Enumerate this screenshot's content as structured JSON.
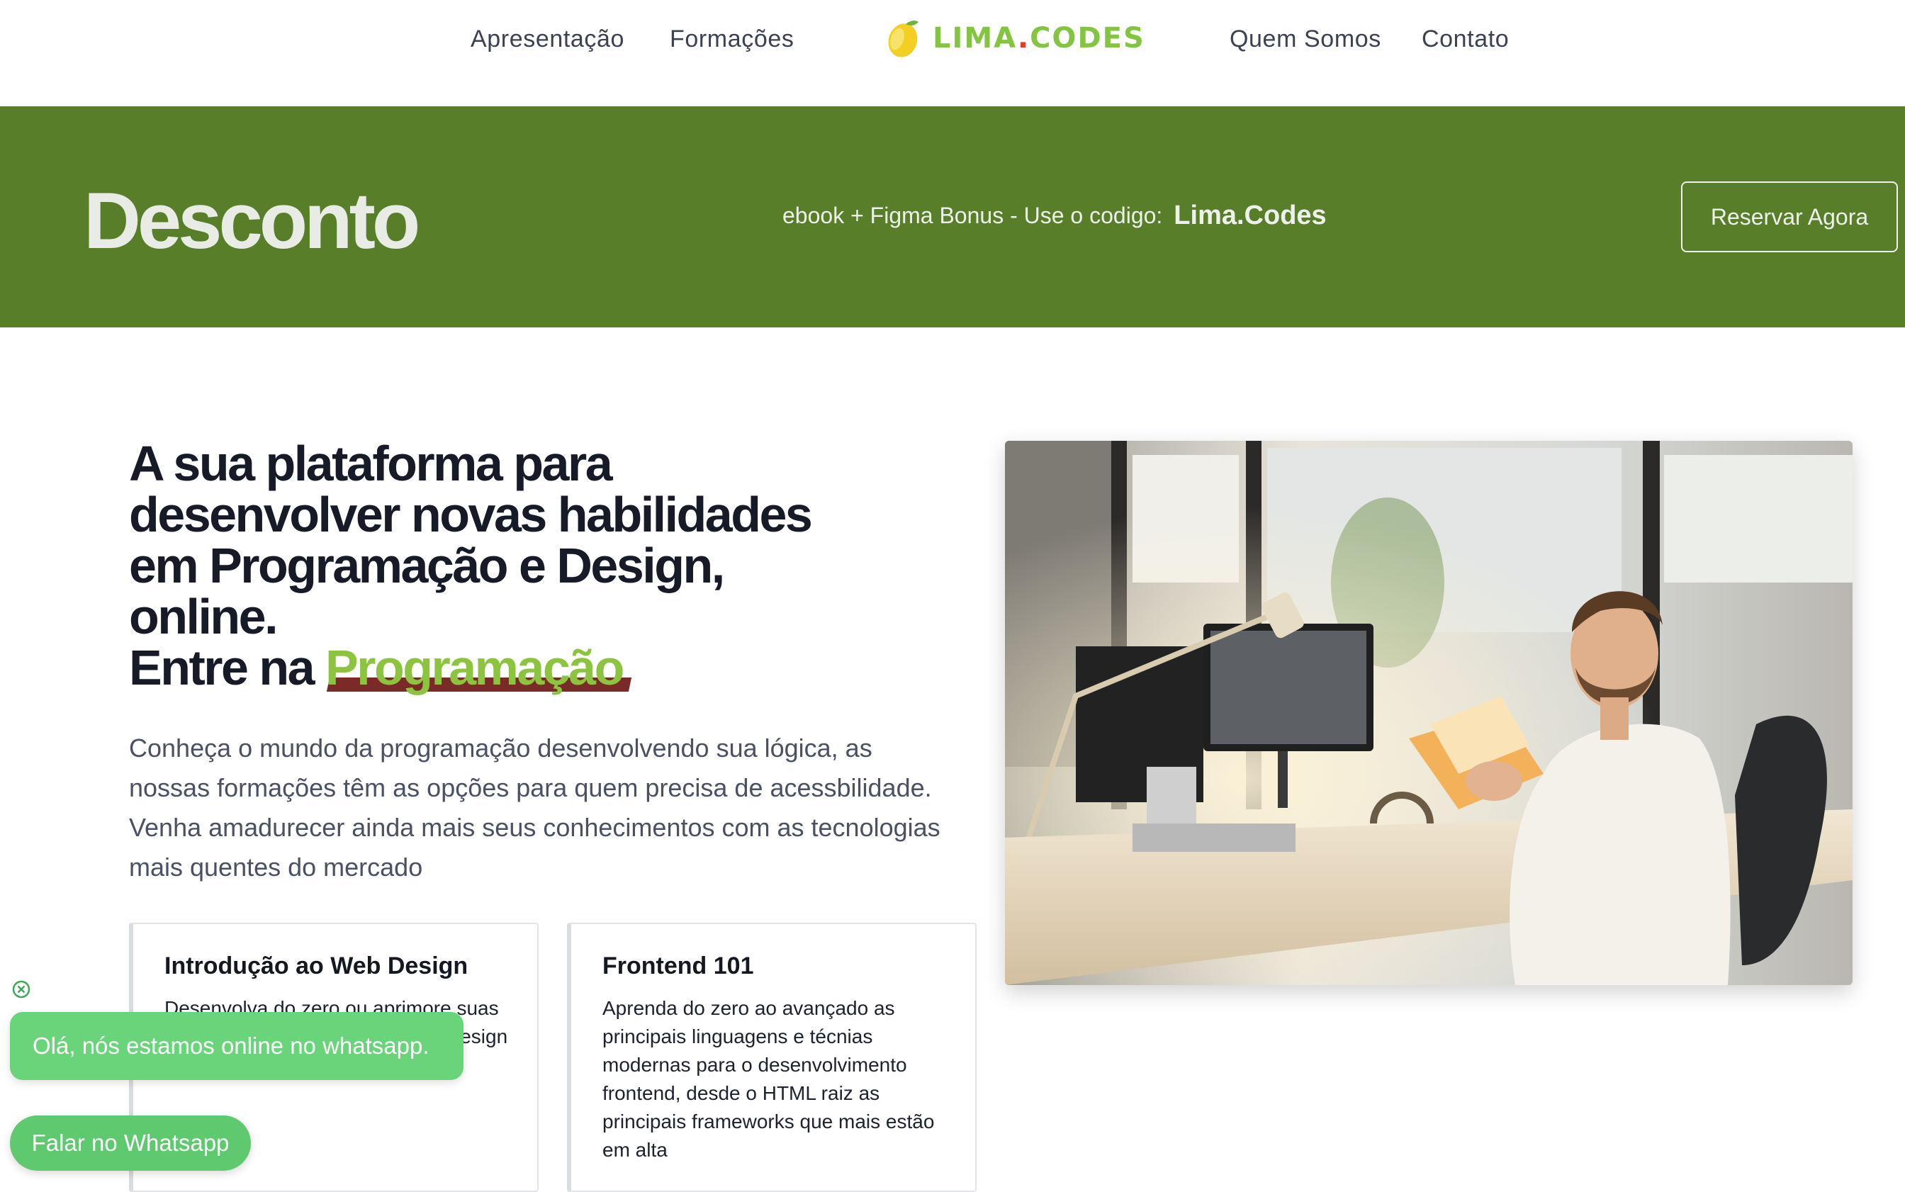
{
  "nav": {
    "links": [
      "Apresentação",
      "Formações",
      "Quem Somos",
      "Contato"
    ],
    "logo_main": "LIMA",
    "logo_dot": ".",
    "logo_suffix": "CODES"
  },
  "banner": {
    "title": "Desconto",
    "offer_text": "ebook + Figma Bonus - Use o codigo:",
    "code": "Lima.Codes",
    "button": "Reservar Agora"
  },
  "hero": {
    "title_lines": [
      "A sua plataforma para",
      "desenvolver novas habilidades",
      "em Programação e Design,",
      "online."
    ],
    "title_prefix": "Entre na",
    "highlight": "Programação",
    "description": "Conheça o mundo da programação desenvolvendo sua lógica, as nossas formações têm as opções para quem precisa de acessbilidade. Venha amadurecer ainda mais seus conhecimentos com as tecnologias mais quentes do mercado"
  },
  "cards": [
    {
      "title": "Introdução ao Web Design",
      "description": "Desenvolva do zero ou aprimore suas habilidades de web design para design de aplicações"
    },
    {
      "title": "Frontend 101",
      "description": "Aprenda do zero ao avançado as principais linguagens e técnias modernas para o desenvolvimento frontend, desde o HTML raiz as principais frameworks que mais estão em alta"
    }
  ],
  "whatsapp": {
    "bubble": "Olá, nós estamos online no whatsapp.",
    "button": "Falar no Whatsapp"
  },
  "colors": {
    "brand_green": "#83c441",
    "banner_green": "#587e2a",
    "logo_dot_red": "#e23b26",
    "highlight_bar": "#7a2a27",
    "whatsapp_green": "#6ad47a"
  },
  "icons": {
    "logo": "lemon-icon",
    "whatsapp_close": "close-circle-icon"
  }
}
